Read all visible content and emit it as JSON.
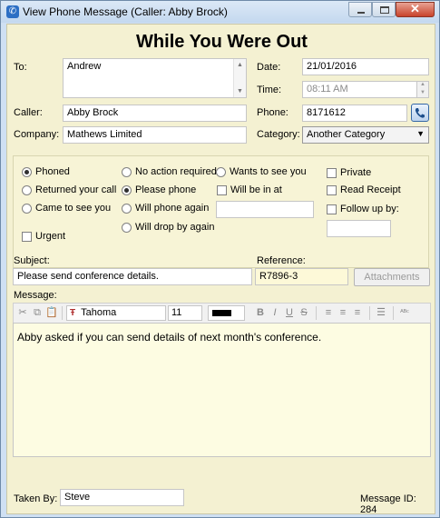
{
  "window": {
    "title": "View Phone Message (Caller: Abby Brock)",
    "close_glyph": "✕"
  },
  "heading": "While You Were Out",
  "to": {
    "label": "To:",
    "value": "Andrew"
  },
  "date": {
    "label": "Date:",
    "value": "21/01/2016"
  },
  "time": {
    "label": "Time:",
    "value": "08:11 AM"
  },
  "caller": {
    "label": "Caller:",
    "value": "Abby Brock"
  },
  "phone": {
    "label": "Phone:",
    "value": "8171612"
  },
  "company": {
    "label": "Company:",
    "value": "Mathews Limited"
  },
  "category": {
    "label": "Category:",
    "value": "Another Category"
  },
  "options": {
    "phoned": "Phoned",
    "returned": "Returned your call",
    "came": "Came to see you",
    "urgent": "Urgent",
    "no_action": "No action required",
    "please_phone": "Please phone",
    "will_phone": "Will phone again",
    "will_drop": "Will drop by again",
    "wants": "Wants to see you",
    "will_be_in": "Will be in at",
    "private": "Private",
    "read_receipt": "Read Receipt",
    "follow_up": "Follow up by:"
  },
  "subject": {
    "label": "Subject:",
    "value": "Please send conference details."
  },
  "reference": {
    "label": "Reference:",
    "value": "R7896-3"
  },
  "attachments_label": "Attachments",
  "message": {
    "label": "Message:",
    "value": "Abby asked if you can send details of next month's conference."
  },
  "toolbar": {
    "font": "Tahoma",
    "size": "11"
  },
  "taken_by": {
    "label": "Taken By:",
    "value": "Steve"
  },
  "message_id": "Message ID: 284",
  "colors": {
    "client_bg": "#f4f1d2",
    "title_bg": "#cfe0f3",
    "message_bg": "#fdfce2"
  }
}
